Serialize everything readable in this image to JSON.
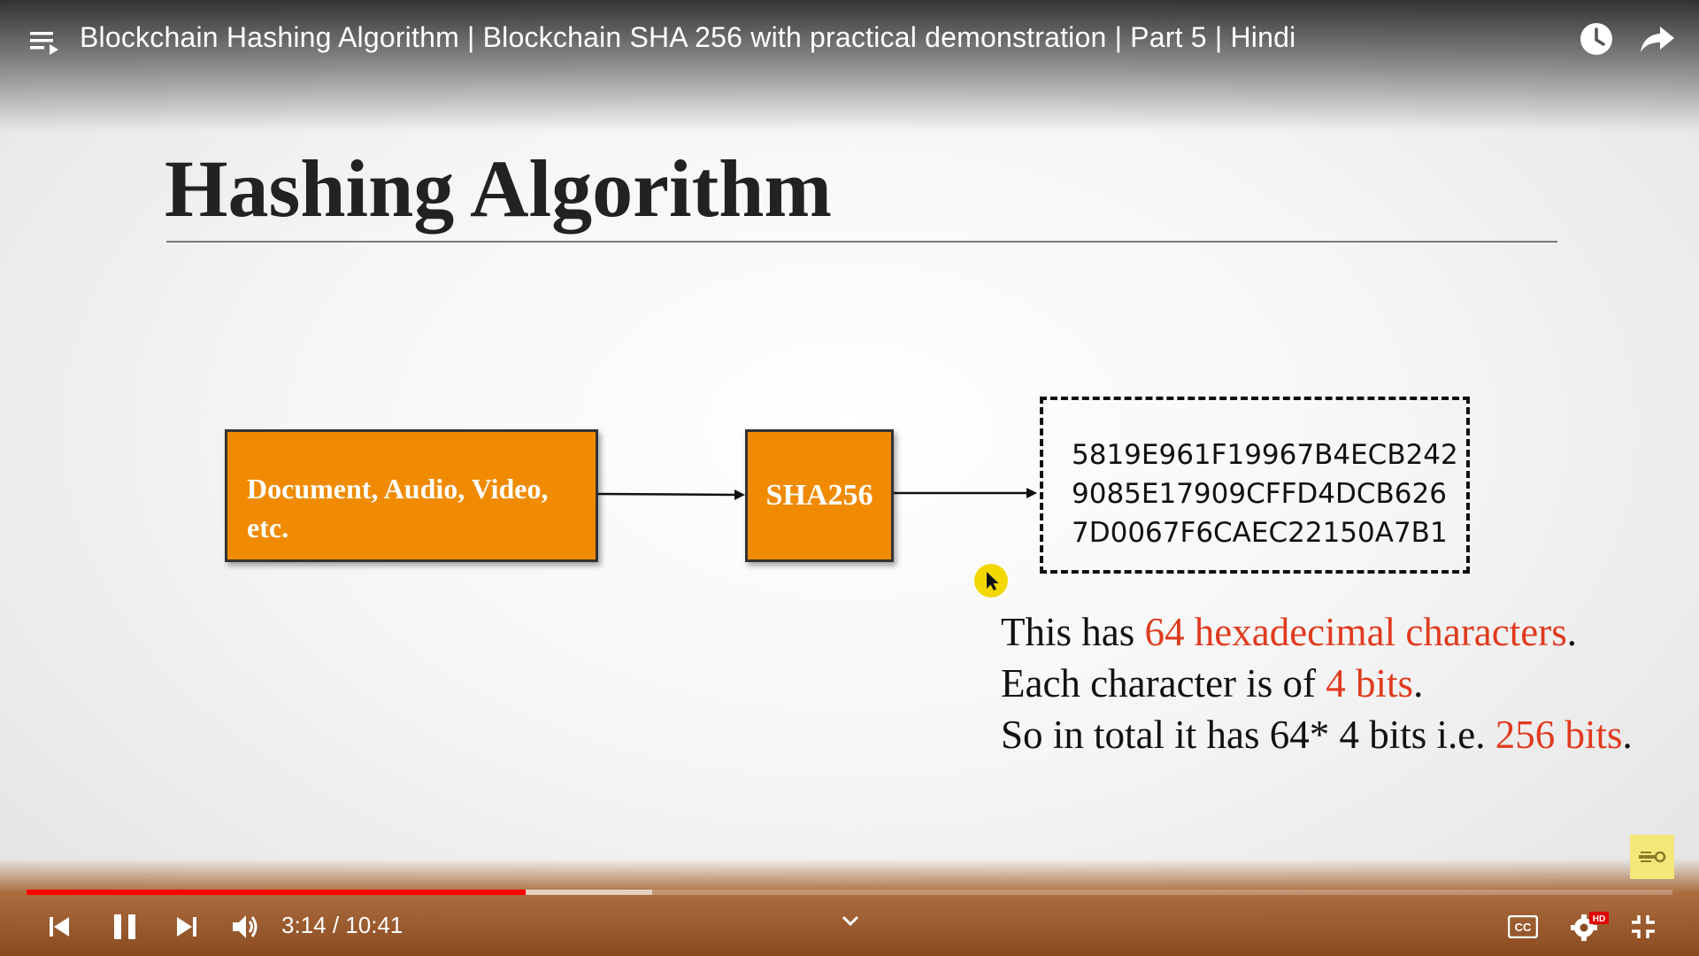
{
  "video": {
    "title": "Blockchain Hashing Algorithm | Blockchain SHA 256 with practical demonstration | Part 5 | Hindi",
    "current_time": "3:14",
    "duration": "10:41",
    "time_text": "3:14 / 10:41",
    "progress_fraction": 0.303,
    "buffered_fraction": 0.38
  },
  "slide": {
    "title": "Hashing Algorithm",
    "input_line1": "Document, Audio, Video,",
    "input_line2": "etc.",
    "algorithm_label": "SHA256",
    "hash_lines": [
      "5819E961F19967B4ECB242",
      "9085E17909CFFD4DCB626",
      "7D0067F6CAEC22150A7B1"
    ],
    "desc1": {
      "pre": "This has ",
      "highlight": "64 hexadecimal characters",
      "post": "."
    },
    "desc2": {
      "pre": "Each character is of ",
      "highlight": "4 bits",
      "post": "."
    },
    "desc3": {
      "pre": "So in total it has 64* 4 bits i.e. ",
      "highlight": "256 bits",
      "post": "."
    }
  },
  "colors": {
    "box_fill": "#f08a00",
    "highlight_red": "#e03a1e",
    "progress_red": "#ff0000"
  },
  "icons": {
    "playlist": "playlist-icon",
    "watch_later": "clock-icon",
    "share": "share-icon",
    "previous": "skip-previous-icon",
    "pause": "pause-icon",
    "next": "skip-next-icon",
    "volume": "volume-icon",
    "chevron": "chevron-down-icon",
    "captions": "cc-icon",
    "settings": "gear-icon",
    "fullscreen_exit": "exit-fullscreen-icon"
  },
  "settings_badge": "HD",
  "captions_label": "CC"
}
